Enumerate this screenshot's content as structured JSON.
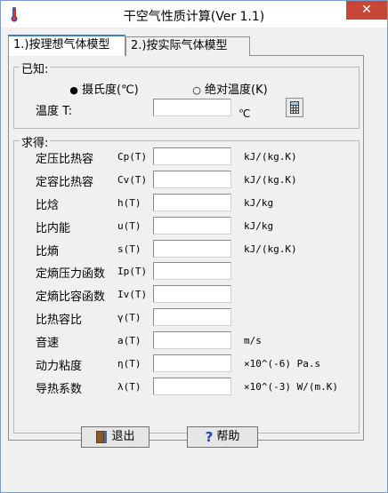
{
  "window": {
    "title": "干空气性质计算(Ver 1.1)",
    "close_symbol": "✕"
  },
  "tabs": [
    {
      "label": "1.)按理想气体模型",
      "active": true
    },
    {
      "label": "2.)按实际气体模型",
      "active": false
    }
  ],
  "known": {
    "group_title": "已知:",
    "radio_celsius": "摄氏度(℃)",
    "radio_kelvin": "绝对温度(K)",
    "selected": "celsius",
    "temp_label": "温度 T:",
    "temp_value": "",
    "temp_unit": "℃"
  },
  "results": {
    "group_title": "求得:",
    "rows": [
      {
        "label": "定压比热容",
        "symbol": "Cp(T)",
        "value": "",
        "unit": "kJ/(kg.K)"
      },
      {
        "label": "定容比热容",
        "symbol": "Cv(T)",
        "value": "",
        "unit": "kJ/(kg.K)"
      },
      {
        "label": "比焓",
        "symbol": "h(T)",
        "value": "",
        "unit": "kJ/kg"
      },
      {
        "label": "比内能",
        "symbol": "u(T)",
        "value": "",
        "unit": "kJ/kg"
      },
      {
        "label": "比熵",
        "symbol": "s(T)",
        "value": "",
        "unit": "kJ/(kg.K)"
      },
      {
        "label": "定熵压力函数",
        "symbol": "Ip(T)",
        "value": "",
        "unit": ""
      },
      {
        "label": "定熵比容函数",
        "symbol": "Iv(T)",
        "value": "",
        "unit": ""
      },
      {
        "label": "比热容比",
        "symbol": "γ(T)",
        "value": "",
        "unit": ""
      },
      {
        "label": "音速",
        "symbol": "a(T)",
        "value": "",
        "unit": "m/s"
      },
      {
        "label": "动力粘度",
        "symbol": "η(T)",
        "value": "",
        "unit": "×10^(-6) Pa.s"
      },
      {
        "label": "导热系数",
        "symbol": "λ(T)",
        "value": "",
        "unit": "×10^(-3) W/(m.K)"
      }
    ]
  },
  "buttons": {
    "exit_label": "退出",
    "help_label": "帮助",
    "help_symbol": "?"
  },
  "colors": {
    "close": "#c7463a",
    "tab_accent": "#3c7fb1",
    "help_icon": "#1a3fbf"
  }
}
